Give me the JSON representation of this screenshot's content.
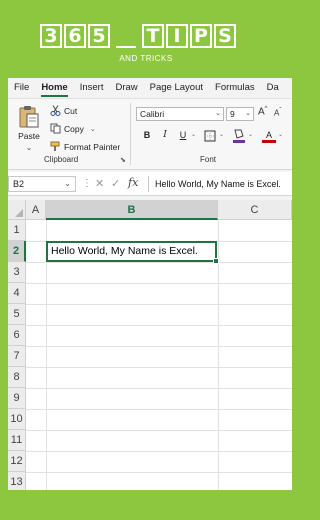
{
  "brand": {
    "logo_chars": [
      "3",
      "6",
      "5",
      "T",
      "I",
      "P",
      "S"
    ],
    "subtitle": "AND TRICKS",
    "color": "#8dc63f"
  },
  "ribbon": {
    "tabs": [
      {
        "label": "File",
        "active": false
      },
      {
        "label": "Home",
        "active": true
      },
      {
        "label": "Insert",
        "active": false
      },
      {
        "label": "Draw",
        "active": false
      },
      {
        "label": "Page Layout",
        "active": false
      },
      {
        "label": "Formulas",
        "active": false
      },
      {
        "label": "Da",
        "active": false
      }
    ],
    "clipboard": {
      "paste_label": "Paste",
      "cut_label": "Cut",
      "copy_label": "Copy",
      "format_painter_label": "Format Painter",
      "group_label": "Clipboard"
    },
    "font": {
      "font_name": "Calibri",
      "font_size": "9",
      "grow_label": "A",
      "shrink_label": "A",
      "bold_label": "B",
      "italic_label": "I",
      "underline_label": "U",
      "font_color_label": "A",
      "group_label": "Font",
      "font_color": "#c00000",
      "highlight_color": "#7030a0"
    }
  },
  "formula_bar": {
    "name_box": "B2",
    "fx_label": "fx",
    "content": "Hello World, My Name is Excel."
  },
  "grid": {
    "columns": [
      "A",
      "B",
      "C"
    ],
    "selected_column": "B",
    "rows": [
      "1",
      "2",
      "3",
      "4",
      "5",
      "6",
      "7",
      "8",
      "9",
      "10",
      "11",
      "12",
      "13"
    ],
    "selected_row": "2",
    "cells": {
      "B2": "Hello World, My Name is Excel."
    },
    "accent": "#217346"
  }
}
